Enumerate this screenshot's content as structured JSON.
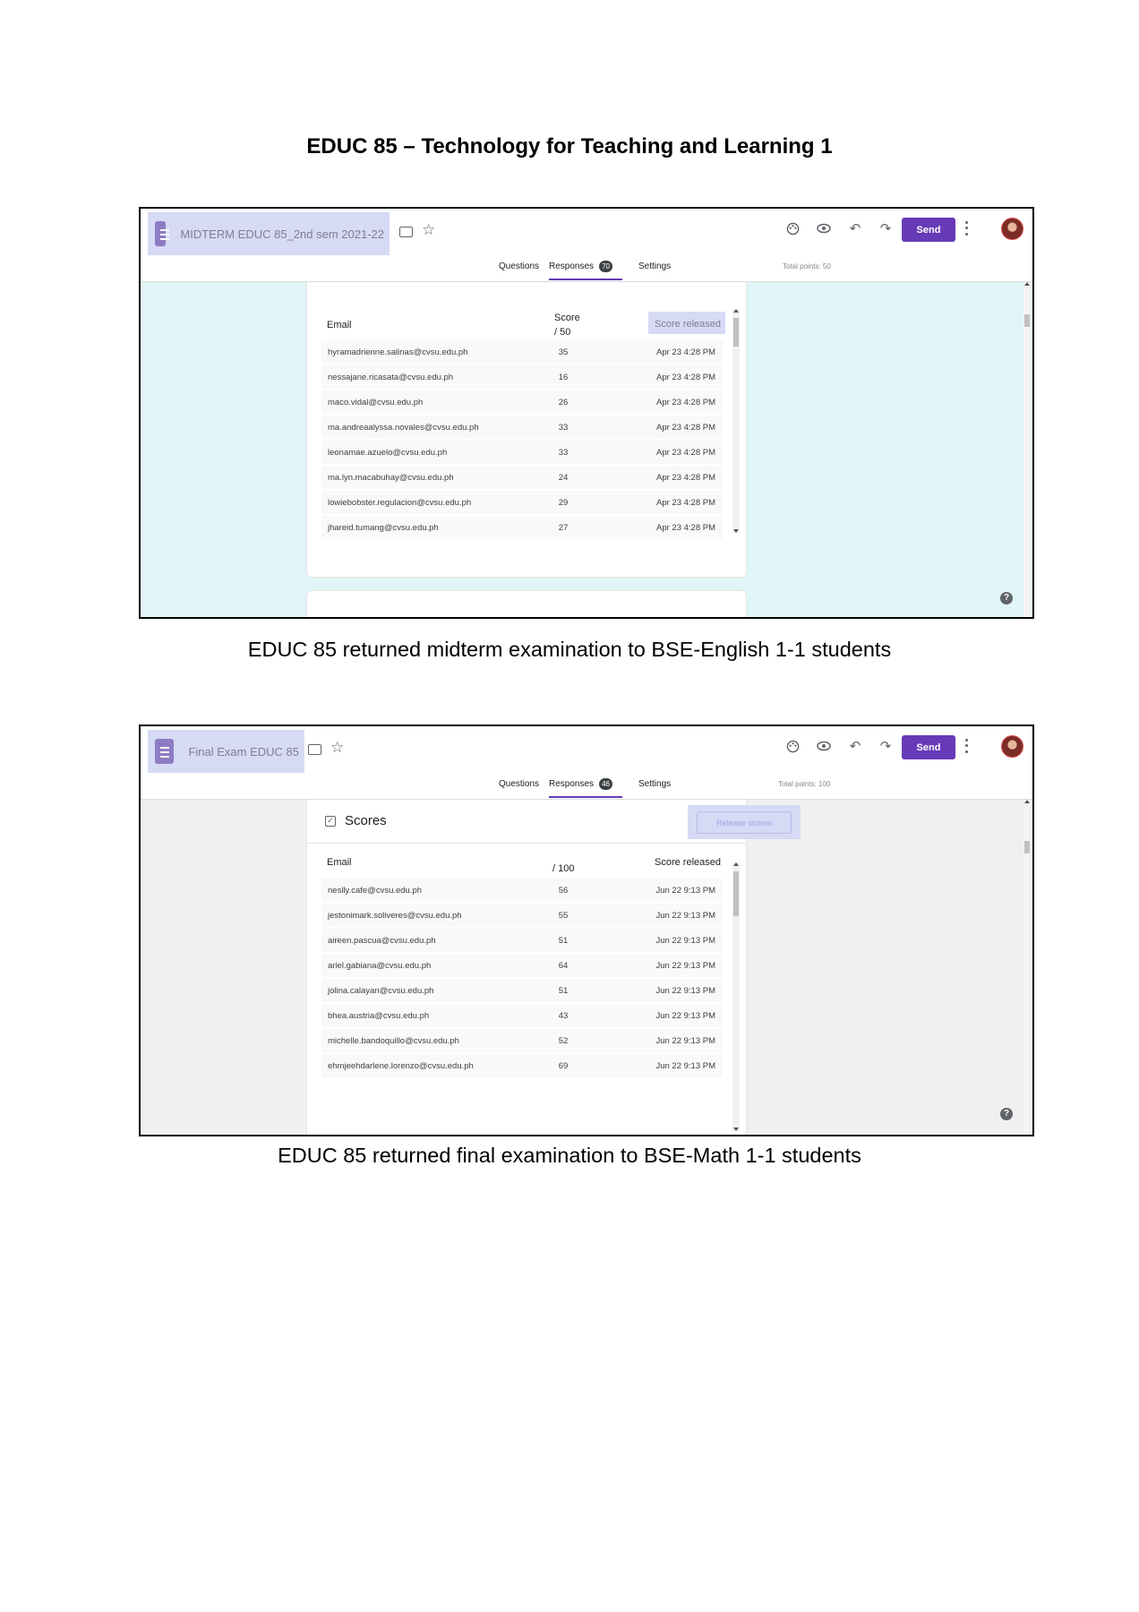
{
  "document": {
    "title": "EDUC 85 – Technology for Teaching and Learning 1"
  },
  "colors": {
    "accent": "#673ab7",
    "highlight": "#d6daf5",
    "canvas_midterm": "#e0f5f7",
    "canvas_final": "#f0f0f0"
  },
  "midterm": {
    "caption": "EDUC 85 returned midterm examination to BSE-English 1-1 students",
    "form_title": "MIDTERM EDUC 85_2nd sem 2021-22",
    "tabs": {
      "questions": "Questions",
      "responses": "Responses",
      "responses_count": "70",
      "settings": "Settings"
    },
    "total_points": "Total points: 50",
    "send_label": "Send",
    "columns": {
      "email": "Email",
      "score": "Score",
      "score_max": "/ 50",
      "released": "Score released"
    },
    "rows": [
      {
        "email": "hyramadrienne.salinas@cvsu.edu.ph",
        "score": "35",
        "released": "Apr 23 4:28 PM"
      },
      {
        "email": "nessajane.ricasata@cvsu.edu.ph",
        "score": "16",
        "released": "Apr 23 4:28 PM"
      },
      {
        "email": "maco.vidal@cvsu.edu.ph",
        "score": "26",
        "released": "Apr 23 4:28 PM"
      },
      {
        "email": "ma.andreaalyssa.novales@cvsu.edu.ph",
        "score": "33",
        "released": "Apr 23 4:28 PM"
      },
      {
        "email": "leonamae.azuelo@cvsu.edu.ph",
        "score": "33",
        "released": "Apr 23 4:28 PM"
      },
      {
        "email": "ma.lyn.macabuhay@cvsu.edu.ph",
        "score": "24",
        "released": "Apr 23 4:28 PM"
      },
      {
        "email": "lowiebobster.regulacion@cvsu.edu.ph",
        "score": "29",
        "released": "Apr 23 4:28 PM"
      },
      {
        "email": "jhareid.tumang@cvsu.edu.ph",
        "score": "27",
        "released": "Apr 23 4:28 PM"
      }
    ]
  },
  "final": {
    "caption": "EDUC 85 returned final examination to BSE-Math 1-1 students",
    "form_title": "Final Exam EDUC 85",
    "tabs": {
      "questions": "Questions",
      "responses": "Responses",
      "responses_count": "46",
      "settings": "Settings"
    },
    "total_points": "Total points: 100",
    "send_label": "Send",
    "scores_heading": "Scores",
    "release_button": "Release scores",
    "columns": {
      "email": "Email",
      "score_max": "/ 100",
      "released": "Score released"
    },
    "rows": [
      {
        "email": "neslly.cafe@cvsu.edu.ph",
        "score": "56",
        "released": "Jun 22 9:13 PM"
      },
      {
        "email": "jestonimark.soliveres@cvsu.edu.ph",
        "score": "55",
        "released": "Jun 22 9:13 PM"
      },
      {
        "email": "aireen.pascua@cvsu.edu.ph",
        "score": "51",
        "released": "Jun 22 9:13 PM"
      },
      {
        "email": "ariel.gabiana@cvsu.edu.ph",
        "score": "64",
        "released": "Jun 22 9:13 PM"
      },
      {
        "email": "jolina.calayan@cvsu.edu.ph",
        "score": "51",
        "released": "Jun 22 9:13 PM"
      },
      {
        "email": "bhea.austria@cvsu.edu.ph",
        "score": "43",
        "released": "Jun 22 9:13 PM"
      },
      {
        "email": "michelle.bandoquillo@cvsu.edu.ph",
        "score": "52",
        "released": "Jun 22 9:13 PM"
      },
      {
        "email": "ehmjeehdarlene.lorenzo@cvsu.edu.ph",
        "score": "69",
        "released": "Jun 22 9:13 PM"
      }
    ]
  },
  "icons": [
    "form-icon",
    "folder-icon",
    "star-icon",
    "palette-icon",
    "eye-icon",
    "undo-icon",
    "redo-icon",
    "more-vert-icon",
    "avatar",
    "check-box-icon",
    "help-icon"
  ]
}
